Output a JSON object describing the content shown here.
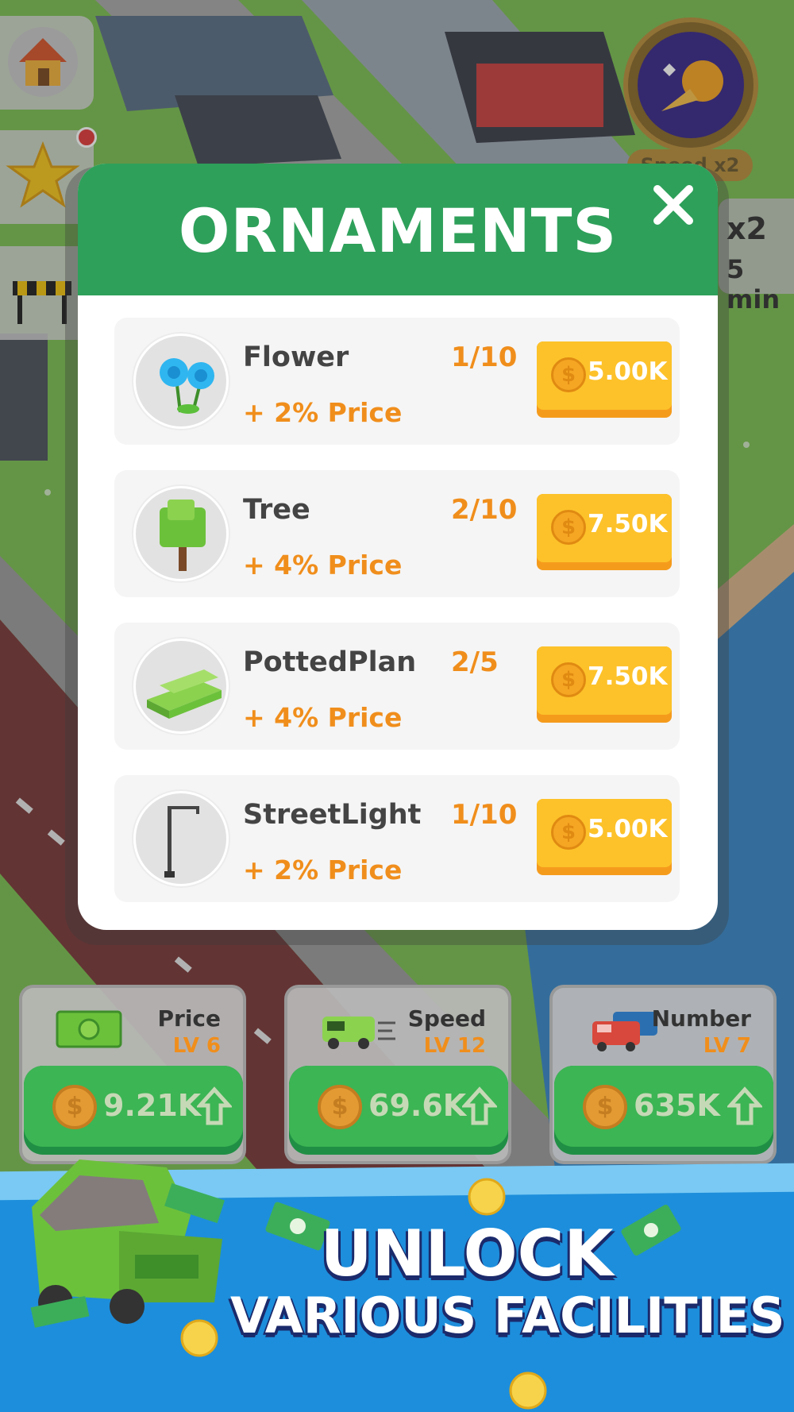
{
  "boost": {
    "label": "Speed x2",
    "side_multiplier": "x2",
    "side_time": "5 min"
  },
  "modal": {
    "title": "ORNAMENTS",
    "close_symbol": "✕",
    "items": [
      {
        "name": "Flower",
        "level": "1/10",
        "bonus": "+ 2% Price",
        "cost": "5.00K",
        "icon": "flower-icon"
      },
      {
        "name": "Tree",
        "level": "2/10",
        "bonus": "+ 4% Price",
        "cost": "7.50K",
        "icon": "tree-icon"
      },
      {
        "name": "PottedPlan",
        "level": "2/5",
        "bonus": "+ 4% Price",
        "cost": "7.50K",
        "icon": "hedge-icon"
      },
      {
        "name": "StreetLight",
        "level": "1/10",
        "bonus": "+ 2% Price",
        "cost": "5.00K",
        "icon": "street-light-icon"
      }
    ]
  },
  "upgrades": [
    {
      "title": "Price",
      "level": "LV 6",
      "cost": "9.21K",
      "icon": "cash-icon"
    },
    {
      "title": "Speed",
      "level": "LV 12",
      "cost": "69.6K",
      "icon": "fast-van-icon"
    },
    {
      "title": "Number",
      "level": "LV 7",
      "cost": "635K",
      "icon": "vehicles-icon"
    }
  ],
  "coin_symbol": "$",
  "promo": {
    "line1": "UNLOCK",
    "line2": "VARIOUS FACILITIES"
  },
  "colors": {
    "header_green": "#2ea05a",
    "buy_yellow": "#fdc22a",
    "accent_orange": "#f08e1c",
    "banner_blue": "#1d8edb"
  }
}
